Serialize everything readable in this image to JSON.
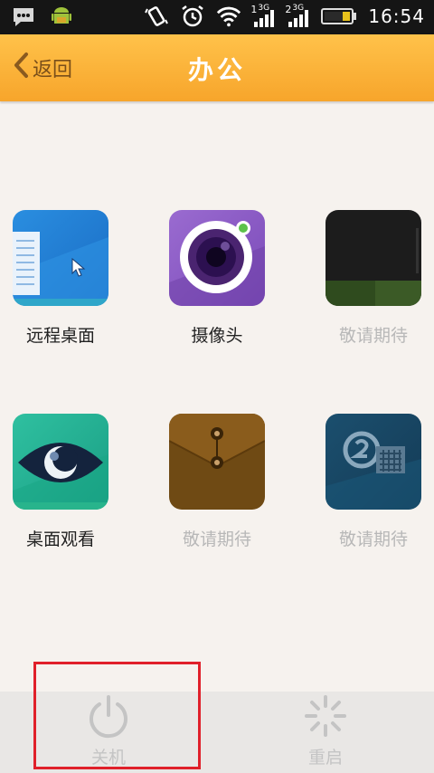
{
  "status_bar": {
    "time": "16:54",
    "sim1": "1",
    "sim2": "2",
    "network1": "3G",
    "network2": "3G",
    "icons": [
      "message-icon",
      "android-icon",
      "vibrate-icon",
      "alarm-icon",
      "wifi-icon",
      "signal-icon",
      "signal-icon",
      "battery-icon"
    ]
  },
  "header": {
    "back_label": "返回",
    "title": "办公"
  },
  "apps": [
    {
      "label": "远程桌面",
      "enabled": true,
      "icon": "remote-desktop-icon"
    },
    {
      "label": "摄像头",
      "enabled": true,
      "icon": "camera-icon"
    },
    {
      "label": "敬请期待",
      "enabled": false,
      "icon": "coming-soon-dark-icon"
    },
    {
      "label": "桌面观看",
      "enabled": true,
      "icon": "eye-icon"
    },
    {
      "label": "敬请期待",
      "enabled": false,
      "icon": "envelope-icon"
    },
    {
      "label": "敬请期待",
      "enabled": false,
      "icon": "calendar-icon"
    }
  ],
  "footer": {
    "shutdown_label": "关机",
    "restart_label": "重启"
  },
  "colors": {
    "header": "#f7a52b",
    "highlight": "#e0202a",
    "background": "#f6f2ee"
  }
}
